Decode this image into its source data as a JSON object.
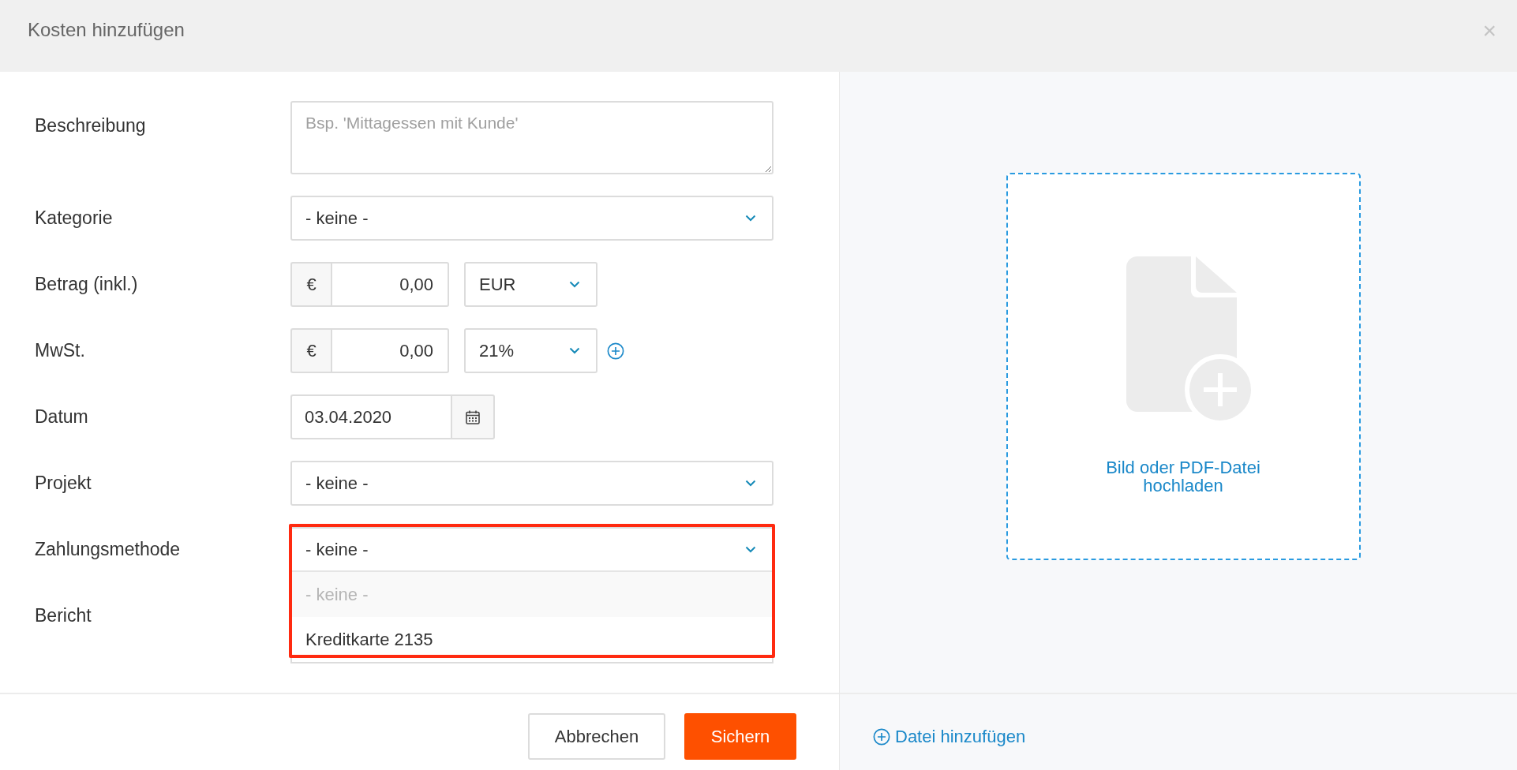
{
  "dialog": {
    "title": "Kosten hinzufügen",
    "close": "×"
  },
  "fields": [
    {
      "kind": "textarea",
      "label": "Beschreibung",
      "placeholder": "Bsp. 'Mittagessen mit Kunde'"
    },
    {
      "kind": "select",
      "label": "Kategorie",
      "value": "- keine -",
      "expanded": false,
      "highlighted": false
    },
    {
      "kind": "amount",
      "label": "Betrag (inkl.)",
      "prefix": "€",
      "value": "0,00",
      "unit": "EUR",
      "add_button": false
    },
    {
      "kind": "amount",
      "label": "MwSt.",
      "prefix": "€",
      "value": "0,00",
      "unit": "21%",
      "add_button": true
    },
    {
      "kind": "date",
      "label": "Datum",
      "value": "03.04.2020"
    },
    {
      "kind": "select",
      "label": "Projekt",
      "value": "- keine -",
      "expanded": false,
      "highlighted": false
    },
    {
      "kind": "select",
      "label": "Zahlungsmethode",
      "value": "- keine -",
      "expanded": true,
      "highlighted": true,
      "options": [
        {
          "label": "- keine -",
          "disabled": true
        },
        {
          "label": "Kreditkarte 2135",
          "disabled": false
        }
      ]
    },
    {
      "kind": "label_only",
      "label": "Bericht"
    }
  ],
  "buttons": [
    {
      "label": "Abbrechen",
      "kind": "secondary"
    },
    {
      "label": "Sichern",
      "kind": "primary"
    }
  ],
  "upload": {
    "text": "Bild oder PDF-Datei hochladen"
  },
  "add_file": {
    "label": "Datei hinzufügen"
  }
}
